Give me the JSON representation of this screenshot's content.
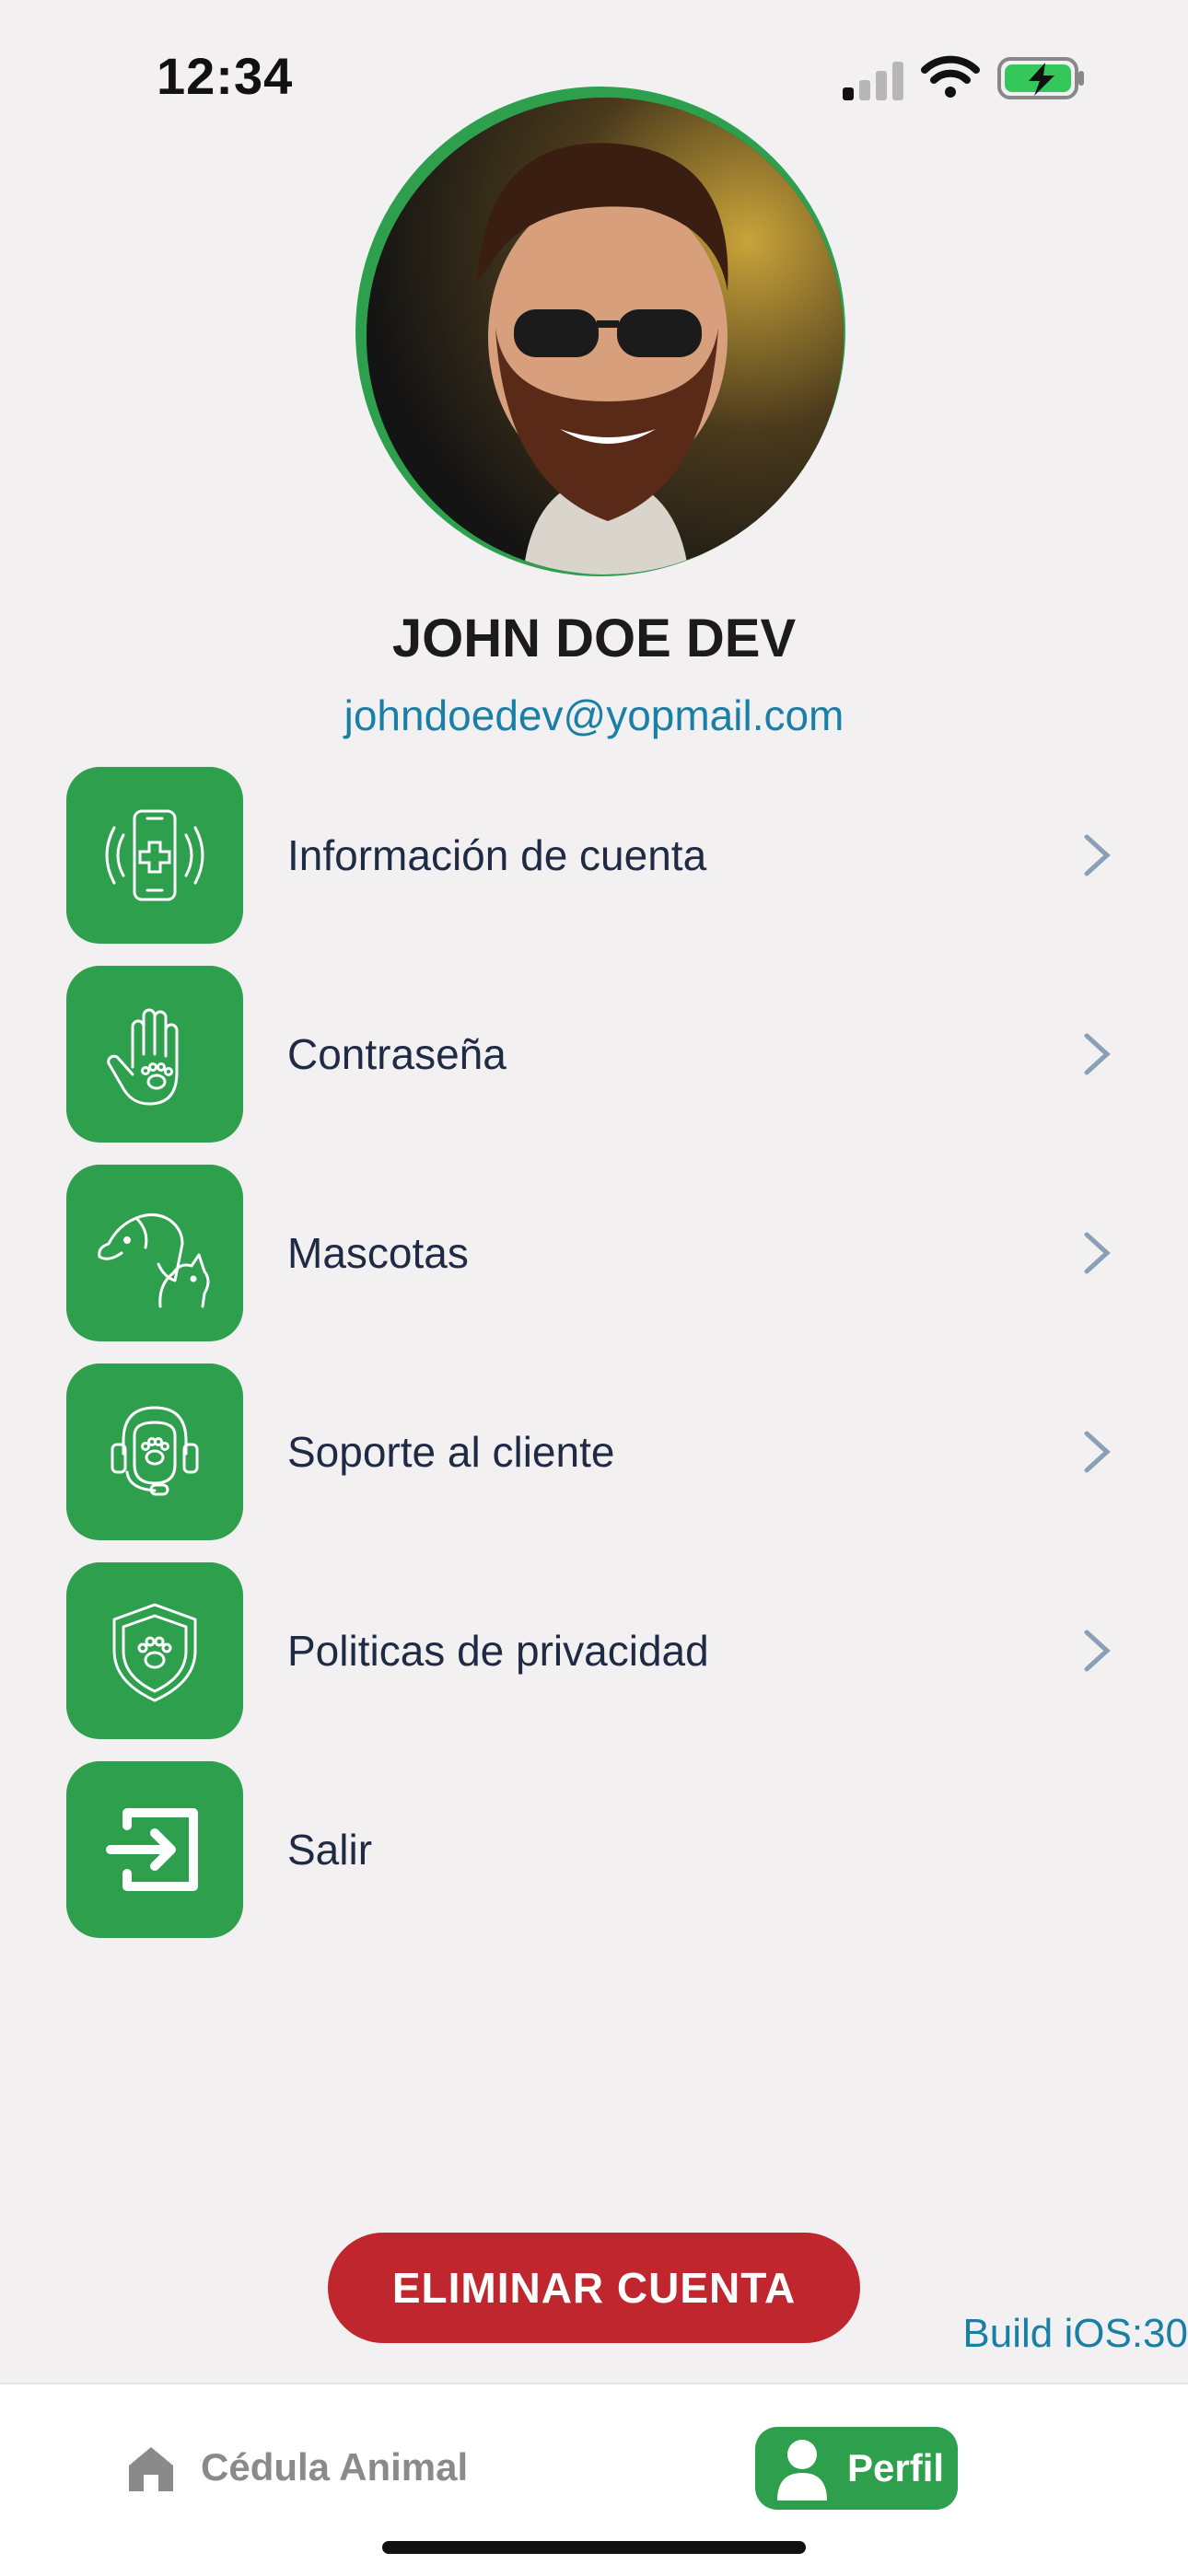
{
  "status_bar": {
    "time": "12:34"
  },
  "profile": {
    "name": "JOHN DOE DEV",
    "email": "johndoedev@yopmail.com"
  },
  "menu": [
    {
      "label": "Información de cuenta",
      "icon": "phone-medical-icon"
    },
    {
      "label": "Contraseña",
      "icon": "hand-paw-icon"
    },
    {
      "label": "Mascotas",
      "icon": "dog-cat-icon"
    },
    {
      "label": "Soporte al cliente",
      "icon": "headset-paw-icon"
    },
    {
      "label": "Politicas de privacidad",
      "icon": "shield-paw-icon"
    },
    {
      "label": "Salir",
      "icon": "logout-icon"
    }
  ],
  "actions": {
    "delete_account": "ELIMINAR CUENTA"
  },
  "build_label": "Build iOS:30",
  "tabbar": {
    "home_label": "Cédula Animal",
    "profile_label": "Perfil"
  },
  "colors": {
    "accent_green": "#2e9f4d",
    "danger_red": "#c0262d",
    "link_blue": "#1a7fa6",
    "background": "#f2f0f1"
  }
}
